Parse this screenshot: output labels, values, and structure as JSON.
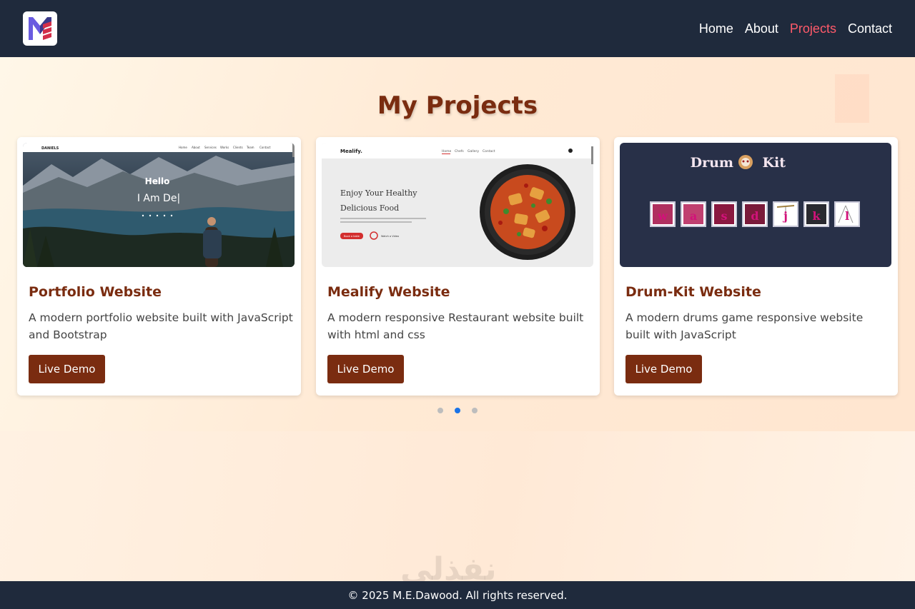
{
  "nav": {
    "links": [
      "Home",
      "About",
      "Projects",
      "Contact"
    ],
    "active": "Projects"
  },
  "section": {
    "title": "My Projects"
  },
  "projects": [
    {
      "title": "Portfolio Website",
      "description": "A modern portfolio website built with JavaScript and Bootstrap",
      "button": "Live Demo",
      "preview": {
        "brand": "DANIELS",
        "menu": [
          "Home",
          "About",
          "Services",
          "Works",
          "Clients",
          "Team",
          "Contact"
        ],
        "hello": "Hello",
        "tagline": "I Am De|"
      }
    },
    {
      "title": "Mealify Website",
      "description": "A modern responsive Restaurant website built with html and css",
      "button": "Live Demo",
      "preview": {
        "brand": "Mealify.",
        "menu": [
          "Home",
          "Chefs",
          "Gallery",
          "Contact"
        ],
        "headline1": "Enjoy Your Healthy",
        "headline2": "Delicious Food",
        "cta": "Book a table",
        "video": "Watch a Video"
      }
    },
    {
      "title": "Drum-Kit Website",
      "description": "A modern drums game responsive website built with JavaScript",
      "button": "Live Demo",
      "preview": {
        "title_left": "Drum",
        "title_right": "Kit",
        "keys": [
          "w",
          "a",
          "s",
          "d",
          "j",
          "k",
          "l"
        ]
      }
    }
  ],
  "carousel": {
    "slides": 3,
    "active_index": 1
  },
  "footer": {
    "text": "© 2025 M.E.Dawood. All rights reserved."
  },
  "watermark": "نفذلي",
  "colors": {
    "nav_bg": "#1f2a3c",
    "accent_active": "#ff5a6a",
    "title_brown": "#7a2c10",
    "button_bg": "#7a2c10",
    "dot_active": "#1a73e8"
  }
}
